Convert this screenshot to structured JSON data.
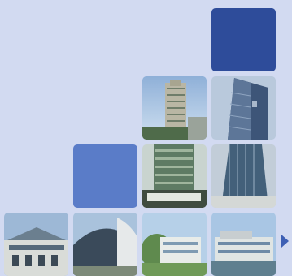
{
  "banner": {
    "tiles": [
      {
        "kind": "solid",
        "color": "#2e4c9a"
      },
      {
        "kind": "photo",
        "subject": "residential-high-rise"
      },
      {
        "kind": "photo",
        "subject": "glass-office-tower"
      },
      {
        "kind": "solid",
        "color": "#5a7cc8"
      },
      {
        "kind": "photo",
        "subject": "green-glass-tower"
      },
      {
        "kind": "photo",
        "subject": "glass-tower"
      },
      {
        "kind": "photo",
        "subject": "industrial-hall"
      },
      {
        "kind": "photo",
        "subject": "curved-facade-building"
      },
      {
        "kind": "photo",
        "subject": "campus-building"
      },
      {
        "kind": "photo",
        "subject": "low-rise-complex"
      }
    ],
    "arrow_icon": "triangle-right-icon",
    "colors": {
      "background": "#d2daf1",
      "tile_dark": "#2e4c9a",
      "tile_mid": "#5a7cc8",
      "arrow": "#3d5fb4"
    }
  }
}
